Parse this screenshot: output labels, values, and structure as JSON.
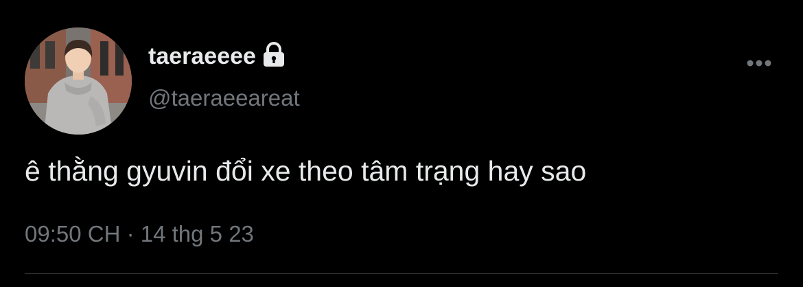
{
  "tweet": {
    "display_name": "taeraeeee",
    "handle": "@taeraeeareat",
    "text": "ê thằng gyuvin đổi xe theo tâm trạng hay sao",
    "time": "09:50 CH",
    "separator": "·",
    "date": "14 thg 5 23",
    "protected_icon": "lock-icon",
    "more_icon": "more-horizontal-icon",
    "avatar": "profile-photo"
  },
  "colors": {
    "background": "#000000",
    "primary_text": "#e7e9ea",
    "secondary_text": "#71767b",
    "divider": "#2f3336"
  }
}
